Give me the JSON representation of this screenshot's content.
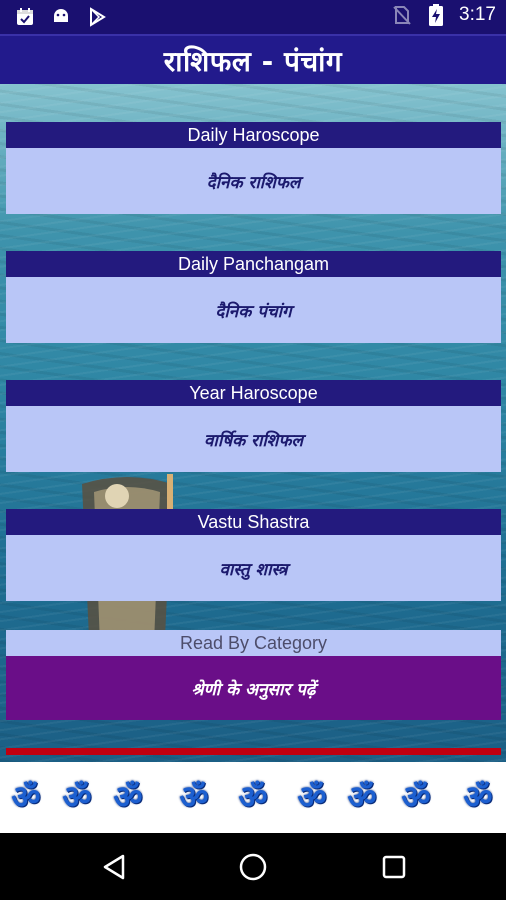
{
  "status_bar": {
    "time": "3:17",
    "left_icons": [
      "calendar-icon",
      "android-icon",
      "play-store-icon"
    ],
    "right_icons": [
      "no-sim-icon",
      "battery-charging-icon"
    ]
  },
  "app_bar": {
    "title": "राशिफल - पंचांग"
  },
  "menu": [
    {
      "header": "Daily Haroscope",
      "label": "दैनिक राशिफल"
    },
    {
      "header": "Daily Panchangam",
      "label": "दैनिक पंचांग"
    },
    {
      "header": "Year Haroscope",
      "label": "वार्षिक राशिफल"
    },
    {
      "header": "Vastu Shastra",
      "label": "वास्तु शास्त्र"
    }
  ],
  "category": {
    "header": "Read By Category",
    "label": "श्रेणी के अनुसार पढ़ें"
  },
  "om_strip": {
    "symbol": "ॐ",
    "count": 9
  },
  "colors": {
    "primary": "#231a7e",
    "card_body": "#b9c6f7",
    "category_body": "#6a0e88",
    "accent_line": "#c00010"
  },
  "nav_bar": {
    "buttons": [
      "back-icon",
      "home-icon",
      "recents-icon"
    ]
  }
}
